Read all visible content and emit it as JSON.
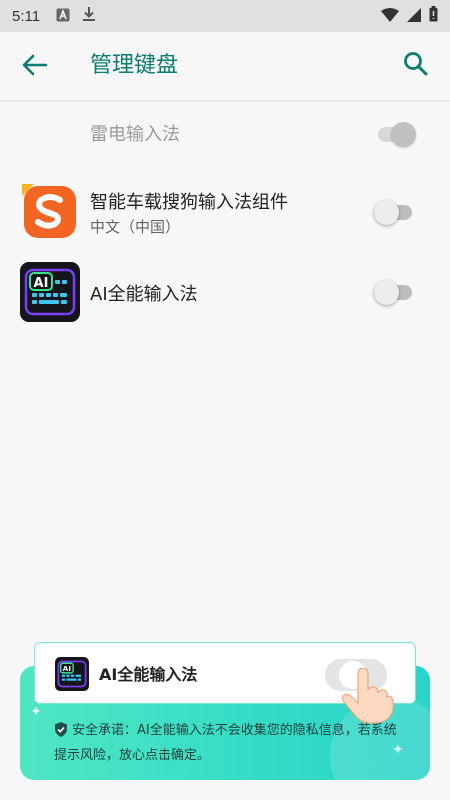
{
  "status_bar": {
    "time": "5:11",
    "left_icons": [
      "app-a-icon",
      "download-icon"
    ],
    "right_icons": [
      "wifi-icon",
      "cellular-icon",
      "battery-icon"
    ]
  },
  "app_bar": {
    "title": "管理键盘",
    "back_icon": "arrow-back-icon",
    "search_icon": "search-icon",
    "accent_color": "#0a7c70"
  },
  "keyboards": [
    {
      "title": "雷电输入法",
      "subtitle": "",
      "enabled": true,
      "disabled": true
    },
    {
      "title": "智能车载搜狗输入法组件",
      "subtitle": "中文（中国）",
      "enabled": false,
      "icon": "sogou-icon"
    },
    {
      "title": "AI全能输入法",
      "subtitle": "",
      "enabled": false,
      "icon": "ai-keyboard-icon"
    }
  ],
  "tip": {
    "app_name": "AI全能输入法",
    "safety_text": "安全承诺：AI全能输入法不会收集您的隐私信息，若系统提示风险，放心点击确定。",
    "toggle_enabled": false
  },
  "icons": {
    "ai_badge": "AI",
    "sogou_letter": "S"
  }
}
